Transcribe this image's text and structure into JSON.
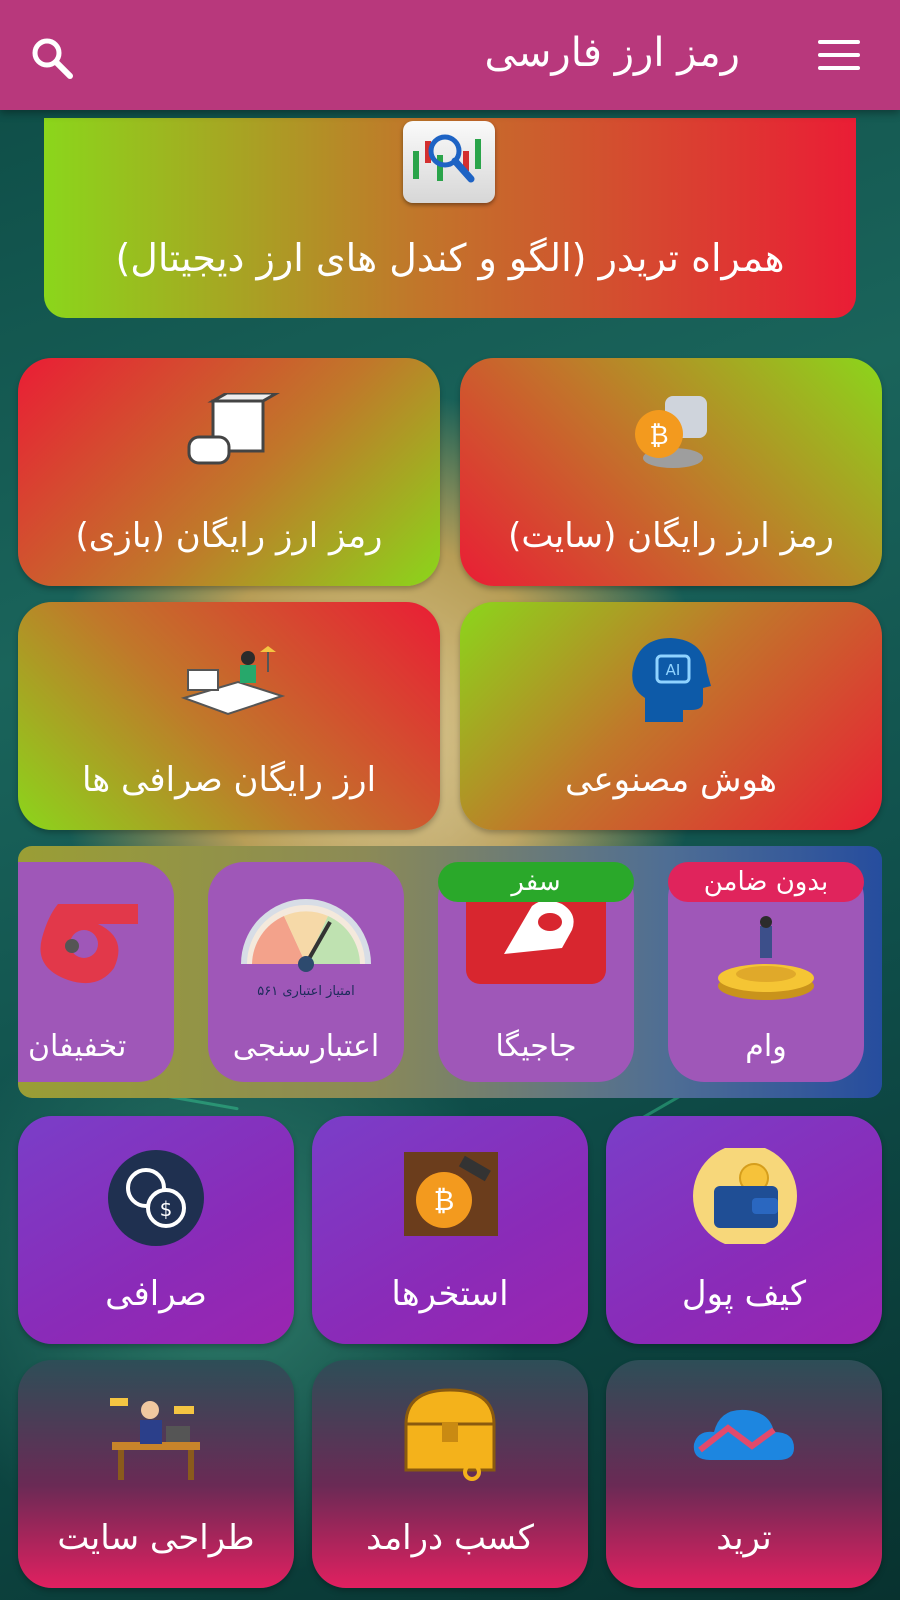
{
  "app": {
    "title": "رمز ارز فارسی"
  },
  "banner": {
    "label": "همراه تریدر (الگو و کندل های ارز دیجیتال)"
  },
  "tiles_top": [
    {
      "label": "رمز ارز رایگان (سایت)"
    },
    {
      "label": "رمز ارز رایگان (بازی)"
    },
    {
      "label": "هوش مصنوعی"
    },
    {
      "label": "ارز رایگان صرافی ها"
    }
  ],
  "carousel": [
    {
      "label": "وام",
      "badge": "بدون ضامن"
    },
    {
      "label": "جاجیگا",
      "badge": "سفر"
    },
    {
      "label": "اعتبارسنجی",
      "gauge_text": "امتیاز اعتباری ۵۶۱"
    },
    {
      "label": "تخفیفان"
    }
  ],
  "tiles_mid": [
    {
      "label": "کیف پول"
    },
    {
      "label": "استخرها"
    },
    {
      "label": "صرافی"
    }
  ],
  "tiles_bottom": [
    {
      "label": "ترید"
    },
    {
      "label": "کسب درامد"
    },
    {
      "label": "طراحی سایت"
    }
  ],
  "colors": {
    "appbar": "#b8387c",
    "accent_red": "#ea1d35",
    "accent_green": "#8bd61b",
    "purple": "#8a2bb8"
  }
}
